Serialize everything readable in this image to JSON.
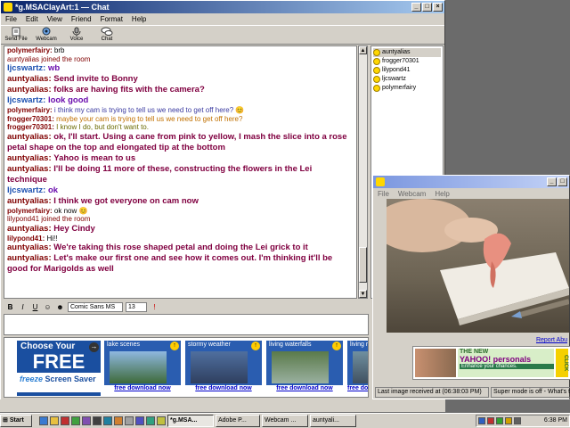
{
  "chat_window": {
    "title": "*g.MSAClayArt:1 — Chat",
    "menu": [
      "File",
      "Edit",
      "View",
      "Friend",
      "Format",
      "Help"
    ],
    "toolbar": [
      "Send File",
      "Webcam",
      "Voice",
      "Chat"
    ],
    "messages": [
      {
        "name": "polymerfairy:",
        "text": "brb",
        "name_color": "#800000",
        "text_color": "#000000",
        "big": false
      },
      {
        "name": "",
        "text": "auntyalias joined the room",
        "name_color": "#800000",
        "text_color": "#800000",
        "big": false
      },
      {
        "name": "ljcswartz:",
        "text": "wb",
        "name_color": "#1a4fb0",
        "text_color": "#6a0dad",
        "big": true
      },
      {
        "name": "auntyalias:",
        "text": "Send invite to Bonny",
        "name_color": "#800000",
        "text_color": "#800040",
        "big": true
      },
      {
        "name": "auntyalias:",
        "text": "folks are having fits with the camera?",
        "name_color": "#800000",
        "text_color": "#800040",
        "big": true
      },
      {
        "name": "ljcswartz:",
        "text": "look good",
        "name_color": "#1a4fb0",
        "text_color": "#6a0dad",
        "big": true
      },
      {
        "name": "polymerfairy:",
        "text": "i think my cam is trying to tell us we need to get off here? 😊",
        "name_color": "#800000",
        "text_color": "#3a3aa0",
        "big": false
      },
      {
        "name": "frogger70301:",
        "text": "maybe your cam is trying to tell us we need to get off here?",
        "name_color": "#800000",
        "text_color": "#c07000",
        "big": false
      },
      {
        "name": "frogger70301:",
        "text": "I know I do, but don't want to.",
        "name_color": "#800000",
        "text_color": "#6a6a00",
        "big": false
      },
      {
        "name": "auntyalias:",
        "text": "ok, I'll start. Using a cane from pink to yellow, I mash the slice into a rose petal shape on the top and elongated tip at the bottom",
        "name_color": "#800000",
        "text_color": "#800040",
        "big": true
      },
      {
        "name": "auntyalias:",
        "text": "Yahoo is mean to us",
        "name_color": "#800000",
        "text_color": "#800040",
        "big": true
      },
      {
        "name": "auntyalias:",
        "text": "I'll be doing 11 more of these, constructing the flowers in the Lei technique",
        "name_color": "#800000",
        "text_color": "#800040",
        "big": true
      },
      {
        "name": "ljcswartz:",
        "text": "ok",
        "name_color": "#1a4fb0",
        "text_color": "#6a0dad",
        "big": true
      },
      {
        "name": "auntyalias:",
        "text": "I think we got everyone on cam now",
        "name_color": "#800000",
        "text_color": "#800040",
        "big": true
      },
      {
        "name": "polymerfairy:",
        "text": "ok now 😊",
        "name_color": "#800000",
        "text_color": "#000000",
        "big": false
      },
      {
        "name": "",
        "text": "lilypond41 joined the room",
        "name_color": "#800000",
        "text_color": "#800000",
        "big": false
      },
      {
        "name": "auntyalias:",
        "text": "Hey Cindy",
        "name_color": "#800000",
        "text_color": "#800040",
        "big": true
      },
      {
        "name": "lilypond41:",
        "text": "Hi!!",
        "name_color": "#800000",
        "text_color": "#000000",
        "big": false
      },
      {
        "name": "auntyalias:",
        "text": "We're taking this rose shaped petal and doing the Lei grick to it",
        "name_color": "#800000",
        "text_color": "#800040",
        "big": true
      },
      {
        "name": "auntyalias:",
        "text": "Let's make our first one and see how it comes out. I'm thinking it'll be good for Marigolds as well",
        "name_color": "#800000",
        "text_color": "#800040",
        "big": true
      }
    ],
    "users": [
      "auntyalias",
      "frogger70301",
      "lilypond41",
      "ljcswartz",
      "polymerfairy"
    ],
    "format": {
      "bold": "B",
      "italic": "I",
      "underline": "U",
      "font": "Comic Sans MS",
      "size": "13"
    }
  },
  "ad": {
    "choose": "Choose Your",
    "free": "FREE",
    "freeze": "freeze",
    "screensaver": "Screen Saver",
    "cards": [
      {
        "title": "lake scenes",
        "link": "free download now"
      },
      {
        "title": "stormy weather",
        "link": "free download now"
      },
      {
        "title": "living waterfalls",
        "link": "free download now"
      },
      {
        "title": "living rain",
        "link": "free download now"
      }
    ]
  },
  "webcam": {
    "menu": [
      "File",
      "Webcam",
      "Help"
    ],
    "report": "Report Abu",
    "ad_line1": "THE NEW",
    "ad_line2": "YAHOO! personals",
    "ad_line3": "Enhance your chances.",
    "ad_click": "CLICK",
    "status_last": "Last image received at (06:38:03 PM)",
    "status_super": "Super mode is off - What's thi"
  },
  "taskbar": {
    "start": "Start",
    "items": [
      "*g.MSA...",
      "Adobe P...",
      "Webcam ...",
      "auntyali..."
    ],
    "clock": "6:38 PM"
  },
  "colors": {
    "titlebar": "#0a246a",
    "face": "#d4d0c8"
  }
}
